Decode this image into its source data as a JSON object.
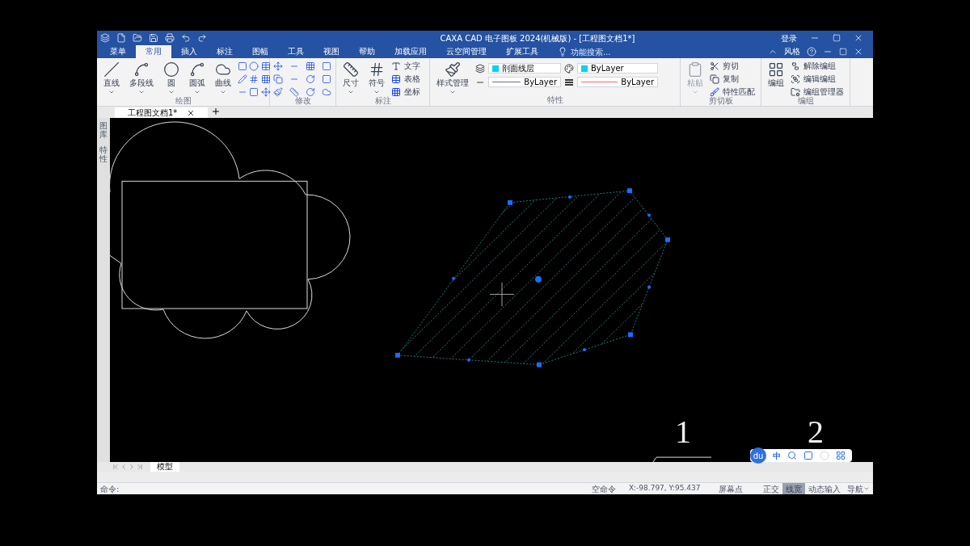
{
  "title_bar": {
    "title": "CAXA CAD 电子图板 2024(机械版) - [工程图文档1*]",
    "login": "登录"
  },
  "menu_tabs": [
    {
      "label": "菜单",
      "selected": false
    },
    {
      "label": "常用",
      "selected": true
    },
    {
      "label": "插入",
      "selected": false
    },
    {
      "label": "标注",
      "selected": false
    },
    {
      "label": "图幅",
      "selected": false
    },
    {
      "label": "工具",
      "selected": false
    },
    {
      "label": "视图",
      "selected": false
    },
    {
      "label": "帮助",
      "selected": false
    },
    {
      "label": "加载应用",
      "selected": false
    },
    {
      "label": "云空间管理",
      "selected": false
    },
    {
      "label": "扩展工具",
      "selected": false
    }
  ],
  "search": {
    "placeholder": "功能搜索..."
  },
  "style_menu": "风格",
  "ribbon": {
    "draw": {
      "title": "绘图",
      "tools": [
        "直线",
        "多段线",
        "圆",
        "圆弧",
        "曲线"
      ]
    },
    "modify": {
      "title": "修改"
    },
    "annotate": {
      "title": "标注",
      "tools": [
        "尺寸",
        "符号"
      ],
      "small_tools": [
        "文字",
        "表格",
        "坐标"
      ]
    },
    "style": {
      "tool": "样式管理"
    },
    "properties": {
      "title": "特性",
      "layer": "剖面线层",
      "color_setting": "ByLayer",
      "linetype": "ByLayer",
      "lineweight": "ByLayer"
    },
    "clipboard": {
      "title": "剪切板",
      "paste": "粘贴",
      "paste_disabled": true,
      "small_tools": [
        "剪切",
        "复制",
        "特性匹配"
      ]
    },
    "group": {
      "title": "编组",
      "tool": "编组",
      "small_tools": [
        "解除编组",
        "编辑编组",
        "编组管理器"
      ]
    }
  },
  "document_tabs": [
    {
      "label": "工程图文档1*",
      "selected": true
    }
  ],
  "side_panel": [
    "图库",
    "特性"
  ],
  "canvas": {
    "labels": [
      "1",
      "2"
    ]
  },
  "ime_toolbar": {
    "logo": "du",
    "mode": "中"
  },
  "layout_tabs": [
    {
      "label": "模型",
      "selected": true
    }
  ],
  "command_line": {
    "prompt": "命令:"
  },
  "status_bar": {
    "command_state": "空命令",
    "coordinates": "X:-98.797, Y:95.437",
    "snap_mode": "屏幕点",
    "toggles": [
      {
        "label": "正交",
        "on": false
      },
      {
        "label": "线宽",
        "on": true
      },
      {
        "label": "动态输入",
        "on": false
      }
    ],
    "navigation": "导航"
  }
}
